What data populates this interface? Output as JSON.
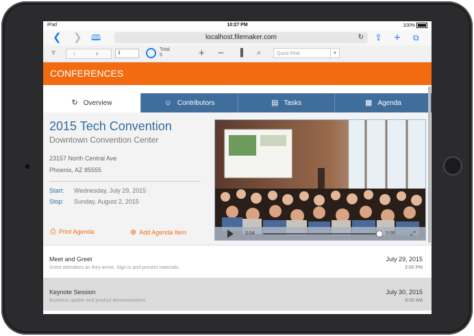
{
  "status": {
    "device": "iPad",
    "time": "10:27 PM",
    "battery": "100%"
  },
  "browser": {
    "url": "localhost.filemaker.com"
  },
  "toolbar": {
    "record": "1",
    "total_label": "Total",
    "total_value": "5",
    "quick_find_placeholder": "Quick Find"
  },
  "header": {
    "title": "CONFERENCES"
  },
  "tabs": [
    {
      "label": "Overview",
      "icon": "refresh-icon"
    },
    {
      "label": "Contributors",
      "icon": "people-icon"
    },
    {
      "label": "Tasks",
      "icon": "tasks-icon"
    },
    {
      "label": "Agenda",
      "icon": "calendar-icon"
    }
  ],
  "event": {
    "title": "2015 Tech Convention",
    "venue": "Downtown Convention Center",
    "address1": "23157 North Central Ave",
    "address2": "Phoenix, AZ 85555",
    "start_label": "Start:",
    "start": "Wednesday, July 29, 2015",
    "stop_label": "Stop:",
    "stop": "Sunday, August 2, 2015"
  },
  "actions": {
    "print": "Print Agenda",
    "add": "Add Agenda Item"
  },
  "video": {
    "elapsed": "0:04",
    "remaining": "0:00",
    "progress": 0.97
  },
  "agenda": [
    {
      "name": "Meet and Greet",
      "desc": "Greet attendees as they arrive. Sign in and present materials.",
      "date": "July 29, 2015",
      "time": "3:00 PM"
    },
    {
      "name": "Keynote Session",
      "desc": "Business update and product demonstrations",
      "date": "July 30, 2015",
      "time": "8:00 AM"
    }
  ],
  "colors": {
    "accent": "#f26b10",
    "tab": "#3f6d9c",
    "title": "#2f6aa3"
  }
}
